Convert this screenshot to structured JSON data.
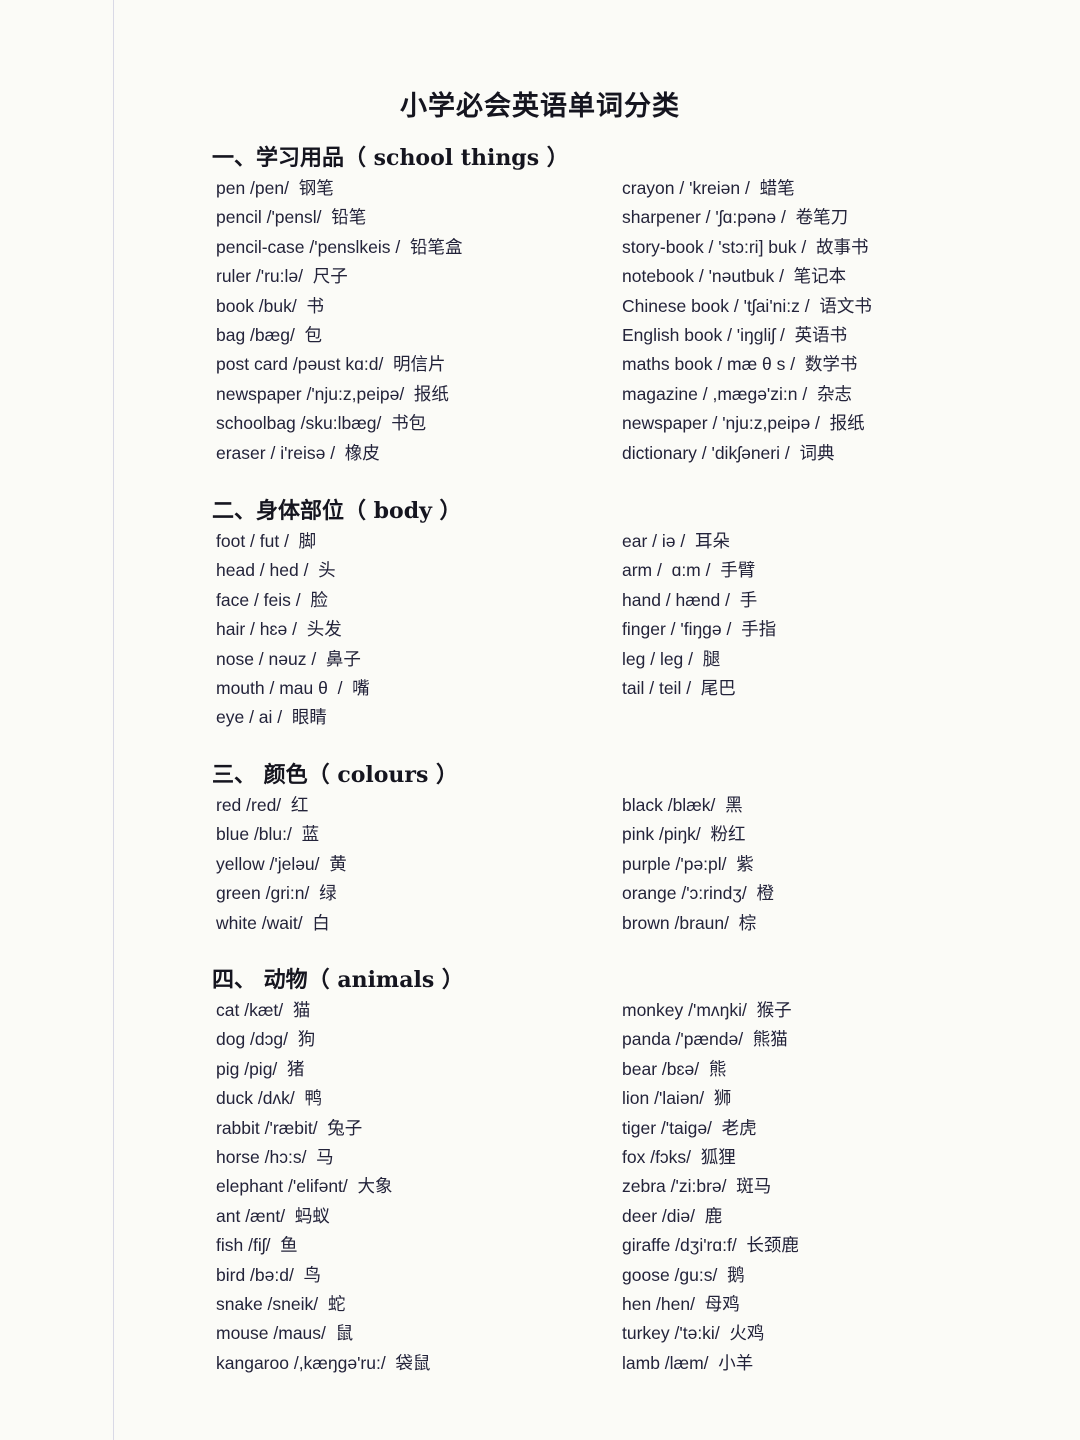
{
  "document": {
    "title": "小学必会英语单词分类",
    "background_color": "#fbfbf7",
    "text_color": "#23233a",
    "margin_rule_color": "#d9d9e6"
  },
  "sections": [
    {
      "heading": "一、学习用品（ school things ）",
      "heading_index": "一、",
      "heading_cn": "学习用品",
      "heading_en": "school things",
      "left_column": [
        "pen /pen/  钢笔",
        "pencil /'pensl/  铅笔",
        "pencil-case /'penslkeis /  铅笔盒",
        "ruler /'ru:lə/  尺子",
        "book /buk/  书",
        "bag /bæg/  包",
        "post card /pəust kɑ:d/  明信片",
        "newspaper /'nju:z,peipə/  报纸",
        "schoolbag /sku:lbæg/  书包",
        "eraser / i'reisə /  橡皮"
      ],
      "right_column": [
        "crayon / 'kreiən /  蜡笔",
        "sharpener / 'ʃɑ:pənə /  卷笔刀",
        "story-book / 'stɔ:ri] buk /  故事书",
        "notebook / 'nəutbuk /  笔记本",
        "Chinese book / 'tʃai'ni:z /  语文书",
        "English book / 'iŋgliʃ /  英语书",
        "maths book / mæ θ s /  数学书",
        "magazine / ,mægə'zi:n /  杂志",
        "newspaper / 'nju:z,peipə /  报纸",
        "dictionary / 'dikʃəneri /  词典"
      ]
    },
    {
      "heading": "二、身体部位（ body ）",
      "heading_index": "二、",
      "heading_cn": "身体部位",
      "heading_en": "body",
      "left_column": [
        "foot / fut /  脚",
        "head / hed /  头",
        "face / feis /  脸",
        "hair / hɛə /  头发",
        "nose / nəuz /  鼻子",
        "mouth / mau θ  /  嘴",
        "eye / ai /  眼睛"
      ],
      "right_column": [
        "ear / iə /  耳朵",
        "arm /  ɑ:m /  手臂",
        "hand / hænd /  手",
        "finger / 'fiŋgə /  手指",
        "leg / leg /  腿",
        "tail / teil /  尾巴"
      ]
    },
    {
      "heading": "三、 颜色（ colours ）",
      "heading_index": "三、",
      "heading_cn": "颜色",
      "heading_en": "colours",
      "left_column": [
        "red /red/  红",
        "blue /blu:/  蓝",
        "yellow /'jeləu/  黄",
        "green /gri:n/  绿",
        "white /wait/  白"
      ],
      "right_column": [
        "black /blæk/  黑",
        "pink /piŋk/  粉红",
        "purple /'pə:pl/  紫",
        "orange /'ɔ:rindʒ/  橙",
        "brown /braun/  棕"
      ]
    },
    {
      "heading": "四、 动物（ animals ）",
      "heading_index": "四、",
      "heading_cn": "动物",
      "heading_en": "animals",
      "left_column": [
        "cat /kæt/  猫",
        "dog /dɔg/  狗",
        "pig /pig/  猪",
        "duck /dʌk/  鸭",
        "rabbit /'ræbit/  兔子",
        "horse /hɔ:s/  马",
        "elephant /'elifənt/  大象",
        "ant /ænt/  蚂蚁",
        "fish /fiʃ/  鱼",
        "bird /bə:d/  鸟",
        "snake /sneik/  蛇",
        "mouse /maus/  鼠",
        "kangaroo /,kæŋgə'ru:/  袋鼠"
      ],
      "right_column": [
        "monkey /'mʌŋki/  猴子",
        "panda /'pændə/  熊猫",
        "bear /bɛə/  熊",
        "lion /'laiən/  狮",
        "tiger /'taigə/  老虎",
        "fox /fɔks/  狐狸",
        "zebra /'zi:brə/  斑马",
        "deer /diə/  鹿",
        "giraffe /dʒi'rɑ:f/  长颈鹿",
        "goose /gu:s/  鹅",
        "hen /hen/  母鸡",
        "turkey /'tə:ki/  火鸡",
        "lamb /læm/  小羊"
      ]
    }
  ]
}
